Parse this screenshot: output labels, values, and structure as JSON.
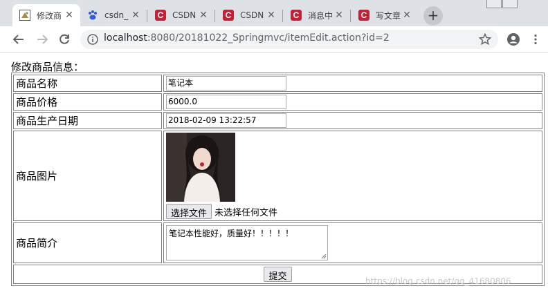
{
  "browser": {
    "tabs": [
      {
        "title": "修改商",
        "favicon": "item-edit-page-icon",
        "active": true
      },
      {
        "title": "csdn_",
        "favicon": "baidu-paw-icon",
        "active": false
      },
      {
        "title": "CSDN",
        "favicon": "csdn-logo-icon",
        "active": false
      },
      {
        "title": "CSDN",
        "favicon": "csdn-logo-icon",
        "active": false
      },
      {
        "title": "消息中",
        "favicon": "csdn-logo-icon",
        "active": false
      },
      {
        "title": "写文章",
        "favicon": "csdn-logo-icon",
        "active": false
      }
    ],
    "csdn_glyph": "C",
    "new_tab_glyph": "+",
    "close_glyph": "✕",
    "address": {
      "host": "localhost",
      "path": ":8080/20181022_Springmvc/itemEdit.action?id=2"
    }
  },
  "page": {
    "heading": "修改商品信息：",
    "fields": {
      "name": {
        "label": "商品名称",
        "value": "笔记本"
      },
      "price": {
        "label": "商品价格",
        "value": "6000.0"
      },
      "date": {
        "label": "商品生产日期",
        "value": "2018-02-09 13:22:57"
      },
      "picture": {
        "label": "商品图片",
        "choose_button": "选择文件",
        "file_status": "未选择任何文件"
      },
      "detail": {
        "label": "商品简介",
        "value": "笔记本性能好，质量好！！！！！"
      }
    },
    "submit_label": "提交",
    "watermark": "https://blog.csdn.net/qq_41680806"
  },
  "colors": {
    "tabstrip_bg": "#dee1e6",
    "omnibox_bg": "#f1f3f4",
    "csdn_red": "#c32136",
    "table_border": "#808080"
  }
}
